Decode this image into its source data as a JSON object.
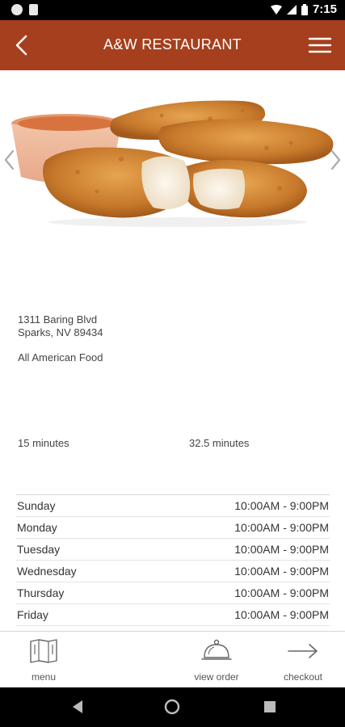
{
  "status_bar": {
    "time": "7:15"
  },
  "app_bar": {
    "title": "A&W RESTAURANT",
    "back_icon": "chevron-left-icon",
    "menu_icon": "hamburger-menu-icon"
  },
  "hero": {
    "image": "chicken-tenders-with-dip",
    "prev_icon": "chevron-left-icon",
    "next_icon": "chevron-right-icon"
  },
  "restaurant": {
    "address_line1": "1311 Baring Blvd",
    "address_line2": "Sparks, NV 89434",
    "cuisine": "All American Food",
    "time_a": "15 minutes",
    "time_b": "32.5 minutes"
  },
  "hours": [
    {
      "day": "Sunday",
      "time": "10:00AM - 9:00PM"
    },
    {
      "day": "Monday",
      "time": "10:00AM - 9:00PM"
    },
    {
      "day": "Tuesday",
      "time": "10:00AM - 9:00PM"
    },
    {
      "day": "Wednesday",
      "time": "10:00AM - 9:00PM"
    },
    {
      "day": "Thursday",
      "time": "10:00AM - 9:00PM"
    },
    {
      "day": "Friday",
      "time": "10:00AM - 9:00PM"
    }
  ],
  "bottom_nav": {
    "menu_label": "menu",
    "view_order_label": "view order",
    "checkout_label": "checkout"
  },
  "colors": {
    "brand": "#a63f1d"
  }
}
